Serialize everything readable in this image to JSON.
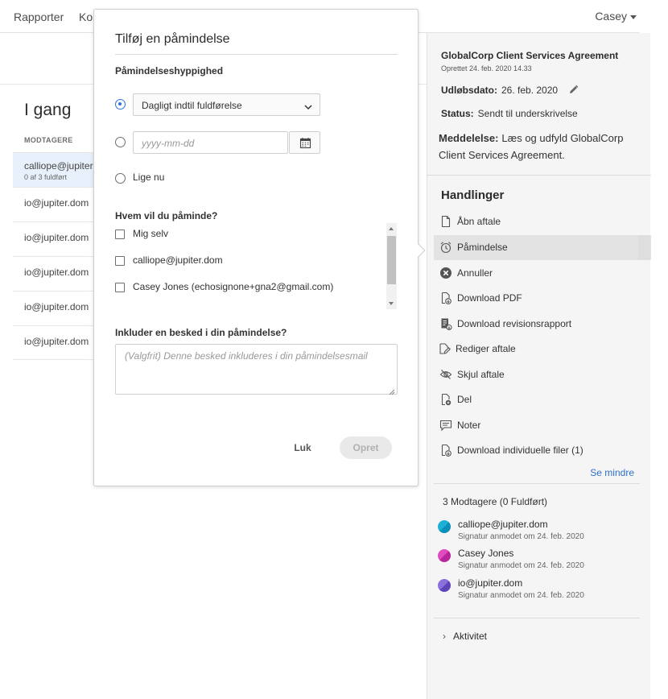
{
  "topbar": {
    "nav_reports": "Rapporter",
    "nav_partial": "Ko",
    "user": "Casey"
  },
  "list": {
    "section_title": "I gang",
    "column_header": "MODTAGERE",
    "rows": [
      {
        "primary": "calliope@jupiter.",
        "secondary": "0 af 3 fuldført"
      },
      {
        "primary": "io@jupiter.dom"
      },
      {
        "primary": "io@jupiter.dom"
      },
      {
        "primary": "io@jupiter.dom"
      },
      {
        "primary": "io@jupiter.dom"
      },
      {
        "primary": "io@jupiter.dom"
      }
    ]
  },
  "modal": {
    "title": "Tilføj en påmindelse",
    "frequency_label": "Påmindelseshyppighed",
    "frequency_value": "Dagligt indtil fuldførelse",
    "date_placeholder": "yyyy-mm-dd",
    "now_label": "Lige nu",
    "who_label": "Hvem vil du påminde?",
    "who_options": [
      "Mig selv",
      "calliope@jupiter.dom",
      "Casey Jones (echosignone+gna2@gmail.com)"
    ],
    "message_label": "Inkluder en besked i din påmindelse?",
    "message_placeholder": "(Valgfrit) Denne besked inkluderes i din påmindelsesmail",
    "close_label": "Luk",
    "create_label": "Opret"
  },
  "panel": {
    "agreement_title": "GlobalCorp Client Services Agreement",
    "created": "Oprettet 24. feb. 2020 14.33",
    "expiry_label": "Udløbsdato:",
    "expiry_value": "26. feb. 2020",
    "status_label": "Status:",
    "status_value": "Sendt til underskrivelse",
    "message_label": "Meddelelse:",
    "message_value": "Læs og udfyld GlobalCorp Client Services Agreement.",
    "actions_heading": "Handlinger",
    "actions": [
      {
        "label": "Åbn aftale",
        "icon": "document-icon"
      },
      {
        "label": "Påmindelse",
        "icon": "alarm-clock-icon"
      },
      {
        "label": "Annuller",
        "icon": "cancel-circle-icon"
      },
      {
        "label": "Download PDF",
        "icon": "download-pdf-icon"
      },
      {
        "label": "Download revisionsrapport",
        "icon": "audit-report-icon"
      },
      {
        "label": "Rediger aftale",
        "icon": "edit-document-icon"
      },
      {
        "label": "Skjul aftale",
        "icon": "hide-eye-icon"
      },
      {
        "label": "Del",
        "icon": "share-document-icon"
      },
      {
        "label": "Noter",
        "icon": "notes-icon"
      },
      {
        "label": "Download individuelle filer (1)",
        "icon": "download-files-icon"
      }
    ],
    "see_less": "Se mindre",
    "recipients_count": "3 Modtagere (0 Fuldført)",
    "recipients": [
      {
        "name": "calliope@jupiter.dom",
        "status": "Signatur anmodet om 24. feb. 2020",
        "color": "#1fb0d8"
      },
      {
        "name": "Casey Jones",
        "status": "Signatur anmodet om 24. feb. 2020",
        "color": "#d63bb0"
      },
      {
        "name": "io@jupiter.dom",
        "status": "Signatur anmodet om 24. feb. 2020",
        "color": "#7a5fd0"
      }
    ],
    "activity": "Aktivitet"
  },
  "colors": {
    "accent": "#2d72d9",
    "link": "#2d6fcc",
    "panel_bg": "#f5f5f5",
    "selected_row": "#e8f1fb"
  }
}
